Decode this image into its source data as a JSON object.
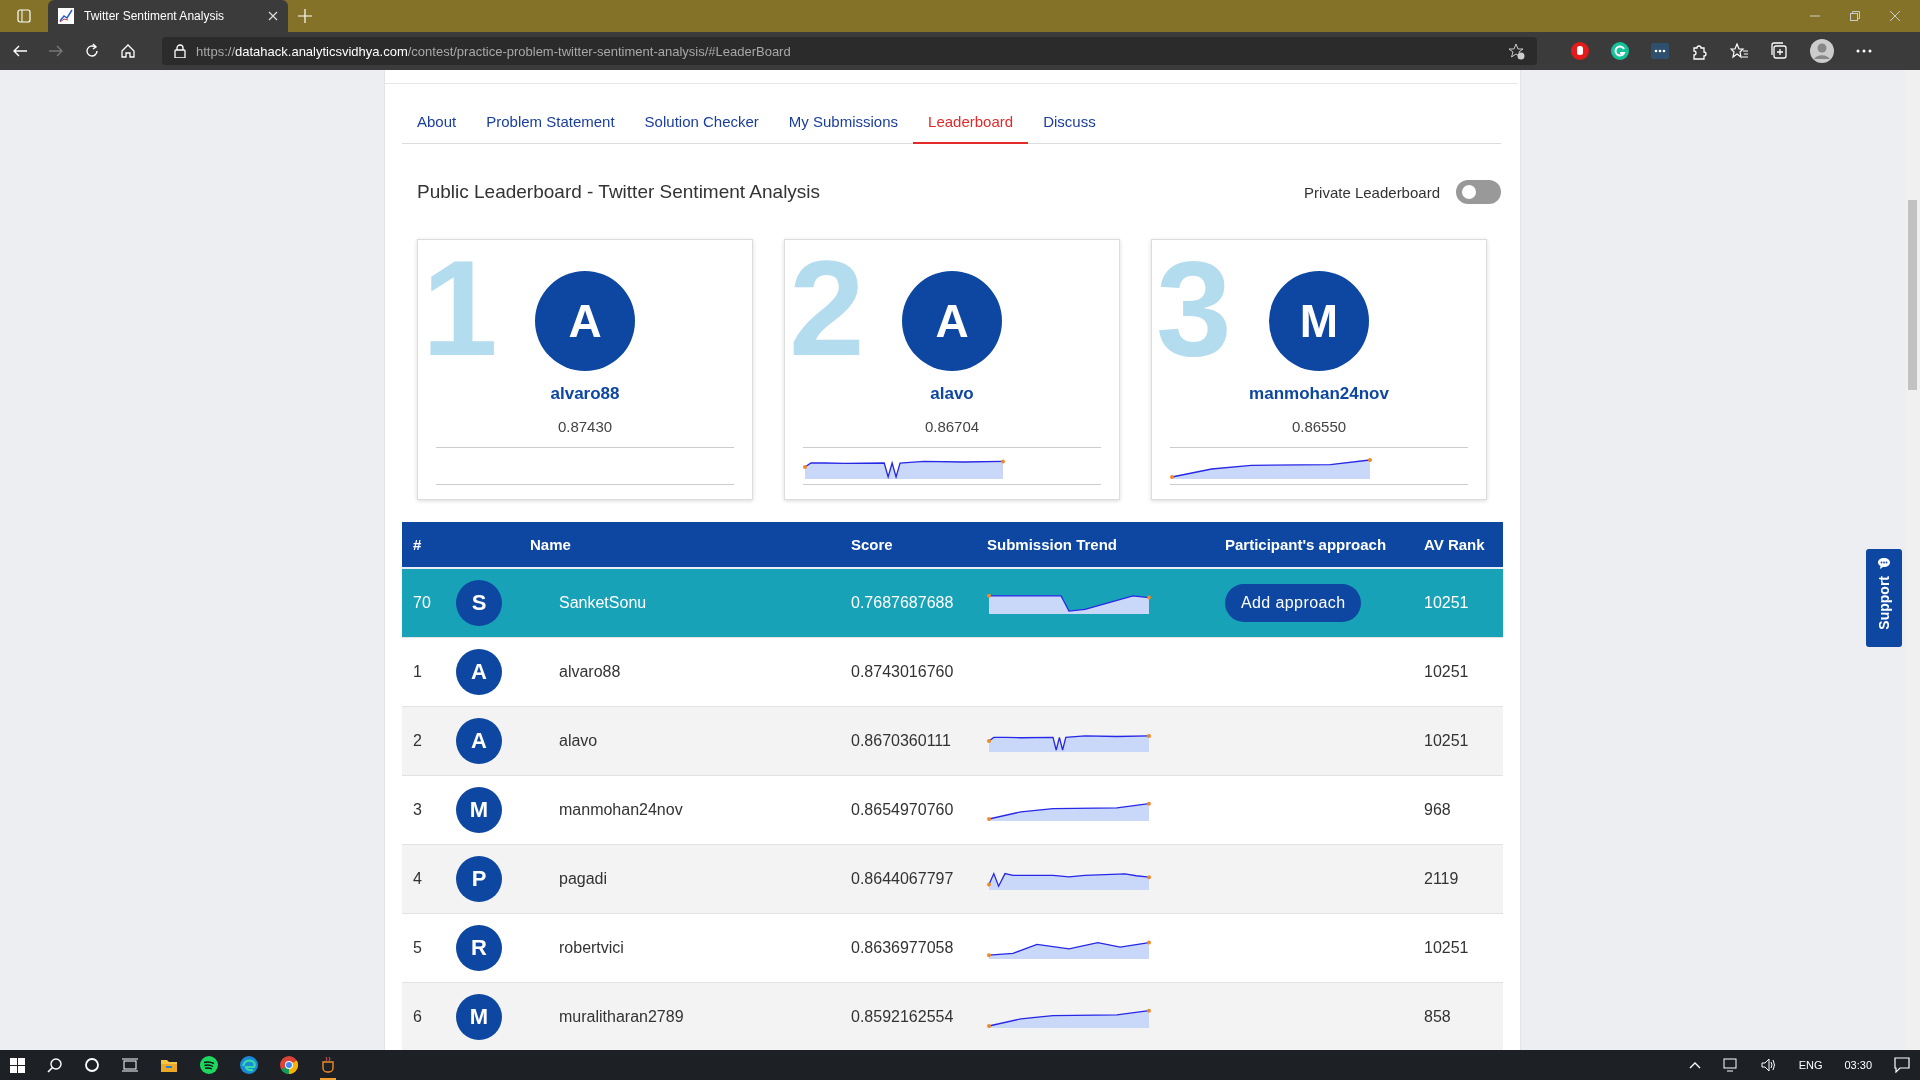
{
  "browser": {
    "tab_title": "Twitter Sentiment Analysis",
    "url": "https://**datahack.analyticsvidhya.com**/contest/practice-problem-twitter-sentiment-analysis/#LeaderBoard"
  },
  "tabs": [
    {
      "label": "About",
      "selected": false
    },
    {
      "label": "Problem Statement",
      "selected": false
    },
    {
      "label": "Solution Checker",
      "selected": false
    },
    {
      "label": "My Submissions",
      "selected": false
    },
    {
      "label": "Leaderboard",
      "selected": true
    },
    {
      "label": "Discuss",
      "selected": false
    }
  ],
  "heading": "Public Leaderboard - Twitter Sentiment Analysis",
  "private_leaderboard": {
    "label": "Private Leaderboard",
    "on": false
  },
  "podium": [
    {
      "place": "1",
      "avatar": "A",
      "name": "alvaro88",
      "score": "0.87430"
    },
    {
      "place": "2",
      "avatar": "A",
      "name": "alavo",
      "score": "0.86704",
      "trend": {
        "kind": "dip"
      }
    },
    {
      "place": "3",
      "avatar": "M",
      "name": "manmohan24nov",
      "score": "0.86550",
      "trend": {
        "kind": "rise"
      }
    }
  ],
  "table": {
    "columns": [
      "#",
      "Name",
      "Score",
      "Submission Trend",
      "Participant's approach",
      "AV Rank"
    ],
    "rows": [
      {
        "rank": "70",
        "avatar": "S",
        "name": "SanketSonu",
        "score": "0.7687687688",
        "trend": {
          "kind": "step"
        },
        "approach_button": "Add approach",
        "av_rank": "10251",
        "highlighted": true
      },
      {
        "rank": "1",
        "avatar": "A",
        "name": "alvaro88",
        "score": "0.8743016760",
        "av_rank": "10251",
        "highlighted": false
      },
      {
        "rank": "2",
        "avatar": "A",
        "name": "alavo",
        "score": "0.8670360111",
        "trend": {
          "kind": "dip"
        },
        "av_rank": "10251",
        "highlighted": false
      },
      {
        "rank": "3",
        "avatar": "M",
        "name": "manmohan24nov",
        "score": "0.8654970760",
        "trend": {
          "kind": "rise"
        },
        "av_rank": "968",
        "highlighted": false
      },
      {
        "rank": "4",
        "avatar": "P",
        "name": "pagadi",
        "score": "0.8644067797",
        "trend": {
          "kind": "jitter"
        },
        "av_rank": "2119",
        "highlighted": false
      },
      {
        "rank": "5",
        "avatar": "R",
        "name": "robertvici",
        "score": "0.8636977058",
        "trend": {
          "kind": "wave"
        },
        "av_rank": "10251",
        "highlighted": false
      },
      {
        "rank": "6",
        "avatar": "M",
        "name": "muralitharan2789",
        "score": "0.8592162554",
        "trend": {
          "kind": "rise"
        },
        "av_rank": "858",
        "highlighted": false
      }
    ]
  },
  "support_label": "Support",
  "taskbar": {
    "language": "ENG",
    "time": "03:30"
  }
}
